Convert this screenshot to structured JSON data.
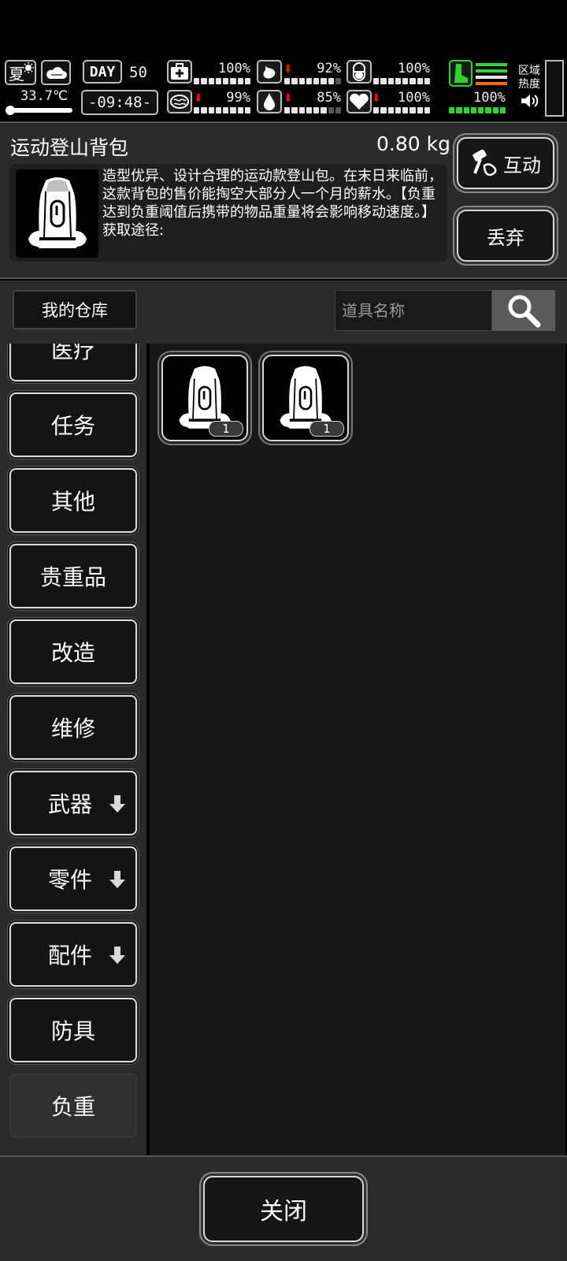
{
  "status": {
    "season": "夏",
    "temperature": "33.7℃",
    "day_label": "DAY",
    "day_number": "50",
    "time": "-09:48-",
    "stats": [
      {
        "name": "health",
        "value": "100%",
        "icon": "medkit-icon",
        "trend": "none"
      },
      {
        "name": "hunger",
        "value": "92%",
        "icon": "stomach-icon",
        "trend": "down"
      },
      {
        "name": "mood",
        "value": "100%",
        "icon": "pill-icon",
        "trend": "none"
      },
      {
        "name": "immunity",
        "value": "99%",
        "icon": "brain-icon",
        "trend": "down"
      },
      {
        "name": "thirst",
        "value": "85%",
        "icon": "water-drop-icon",
        "trend": "down"
      },
      {
        "name": "spirit",
        "value": "100%",
        "icon": "heart-icon",
        "trend": "down"
      }
    ],
    "stamina": "100%",
    "zone_heat_label_1": "区域",
    "zone_heat_label_2": "热度",
    "colors": {
      "stamina": "#2bd62b",
      "heat_orange": "#ff6a00",
      "arrow_red": "#e01010"
    }
  },
  "item": {
    "name": "运动登山背包",
    "weight": "0.80 kg",
    "description": "造型优异、设计合理的运动款登山包。在末日来临前，这款背包的售价能掏空大部分人一个月的薪水。【负重达到负重阈值后携带的物品重量将会影响移动速度。】",
    "source_label": "获取途径:",
    "interact_label": "互动",
    "discard_label": "丢弃"
  },
  "search": {
    "warehouse_label": "我的仓库",
    "placeholder": "道具名称"
  },
  "categories": [
    {
      "label": "医疗",
      "expandable": false
    },
    {
      "label": "任务",
      "expandable": false
    },
    {
      "label": "其他",
      "expandable": false
    },
    {
      "label": "贵重品",
      "expandable": false
    },
    {
      "label": "改造",
      "expandable": false
    },
    {
      "label": "维修",
      "expandable": false
    },
    {
      "label": "武器",
      "expandable": true
    },
    {
      "label": "零件",
      "expandable": true
    },
    {
      "label": "配件",
      "expandable": true
    },
    {
      "label": "防具",
      "expandable": false
    },
    {
      "label": "负重",
      "expandable": false,
      "selected": true
    }
  ],
  "grid": {
    "slots": [
      {
        "icon": "backpack-icon",
        "count": "1"
      },
      {
        "icon": "backpack-icon",
        "count": "1"
      }
    ]
  },
  "footer": {
    "close_label": "关闭"
  }
}
